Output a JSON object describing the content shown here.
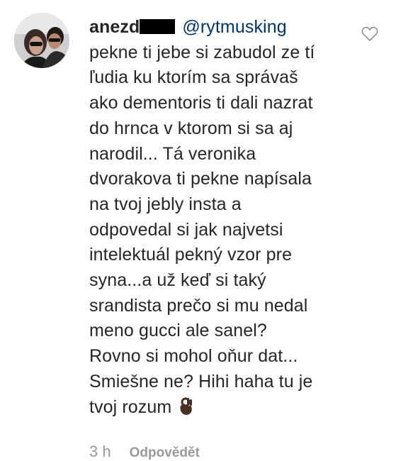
{
  "comment": {
    "username": "anezd",
    "mention": "@rytmusking",
    "lines": [
      "pekne ti jebe si zabudol ze tí",
      "ľudia ku ktorím sa správaš",
      "ako dementoris ti dali nazrat",
      "do hrnca v ktorom si sa aj",
      "narodil... Tá veronika",
      "dvorakova ti pekne napísala",
      "na tvoj jebly insta a",
      "odpovedal si jak najvetsi",
      "intelektuál pekný vzor pre",
      "syna...a už keď si taký",
      "srandista prečo si mu nedal",
      "meno gucci ale sanel?",
      "Rovno si mohol oňur dat...",
      "Smiešne ne? Hihi haha tu je",
      "tvoj rozum"
    ],
    "emoji": "ok-hand-emoji",
    "time": "3 h",
    "reply_label": "Odpovědět"
  },
  "icons": {
    "like": "heart-icon"
  },
  "colors": {
    "text": "#262626",
    "mention": "#003569",
    "meta": "#999999"
  }
}
